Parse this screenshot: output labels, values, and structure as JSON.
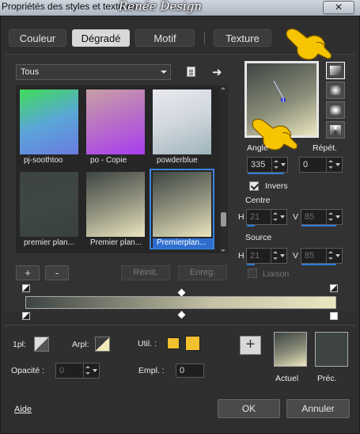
{
  "window": {
    "title": "Propriétés des styles et textures",
    "brand_overlay": "Renée Design",
    "close_label": "✕"
  },
  "tabs": [
    {
      "label": "Couleur",
      "active": false
    },
    {
      "label": "Dégradé",
      "active": true
    },
    {
      "label": "Motif",
      "active": false
    },
    {
      "label": "Texture",
      "active": false
    }
  ],
  "filter": {
    "selected": "Tous"
  },
  "gradients": [
    {
      "label": "pj-soothtoo",
      "colors": [
        "#3fdc5a",
        "#5aa6d8",
        "#6a7be0"
      ]
    },
    {
      "label": "po - Copie",
      "colors": [
        "#c8a0a4",
        "#b86ec8",
        "#a93cf0"
      ]
    },
    {
      "label": "powderblue",
      "colors": [
        "#e9eaf0",
        "#cfd6dc",
        "#9fb4bd"
      ]
    },
    {
      "label": "premier plan...",
      "colors": [
        "#3d4442",
        "#3f4745",
        "#39403f"
      ]
    },
    {
      "label": "Premier plan...",
      "colors": [
        "#3d4442",
        "#8e8f7c",
        "#ece6c0"
      ]
    },
    {
      "label": "Premierplan...",
      "colors": [
        "#3d4442",
        "#8e8f7c",
        "#ece6c0"
      ],
      "selected": true
    }
  ],
  "list_buttons": {
    "add": "+",
    "remove": "-",
    "reset": "Réinit.",
    "save": "Enreg."
  },
  "controls": {
    "angle_label": "Angle",
    "repeat_label": "Répét.",
    "angle_value": "335",
    "repeat_value": "0",
    "invert_label": "Invers",
    "invert_checked": true,
    "center_label": "Centre",
    "center_h_label": "H",
    "center_h": "21",
    "center_v_label": "V",
    "center_v": "85",
    "source_label": "Source",
    "source_h_label": "H",
    "source_h": "21",
    "source_v_label": "V",
    "source_v": "85",
    "link_label": "Liaison",
    "link_checked": false
  },
  "bottom": {
    "first_plan_label": "1pl:",
    "arpl_label": "Arpl:",
    "util_label": "Util. :",
    "opacity_label": "Opacité :",
    "opacity_value": "0",
    "empl_label": "Empl. :",
    "empl_value": "0",
    "current_label": "Actuel",
    "previous_label": "Préc.",
    "add_label": "+"
  },
  "footer": {
    "help": "Aide",
    "ok": "OK",
    "cancel": "Annuler"
  },
  "colors": {
    "foreground": "#3d4442",
    "background": "#ece6c0",
    "accent": "#2f7ad8",
    "util": "#f2c12e"
  }
}
